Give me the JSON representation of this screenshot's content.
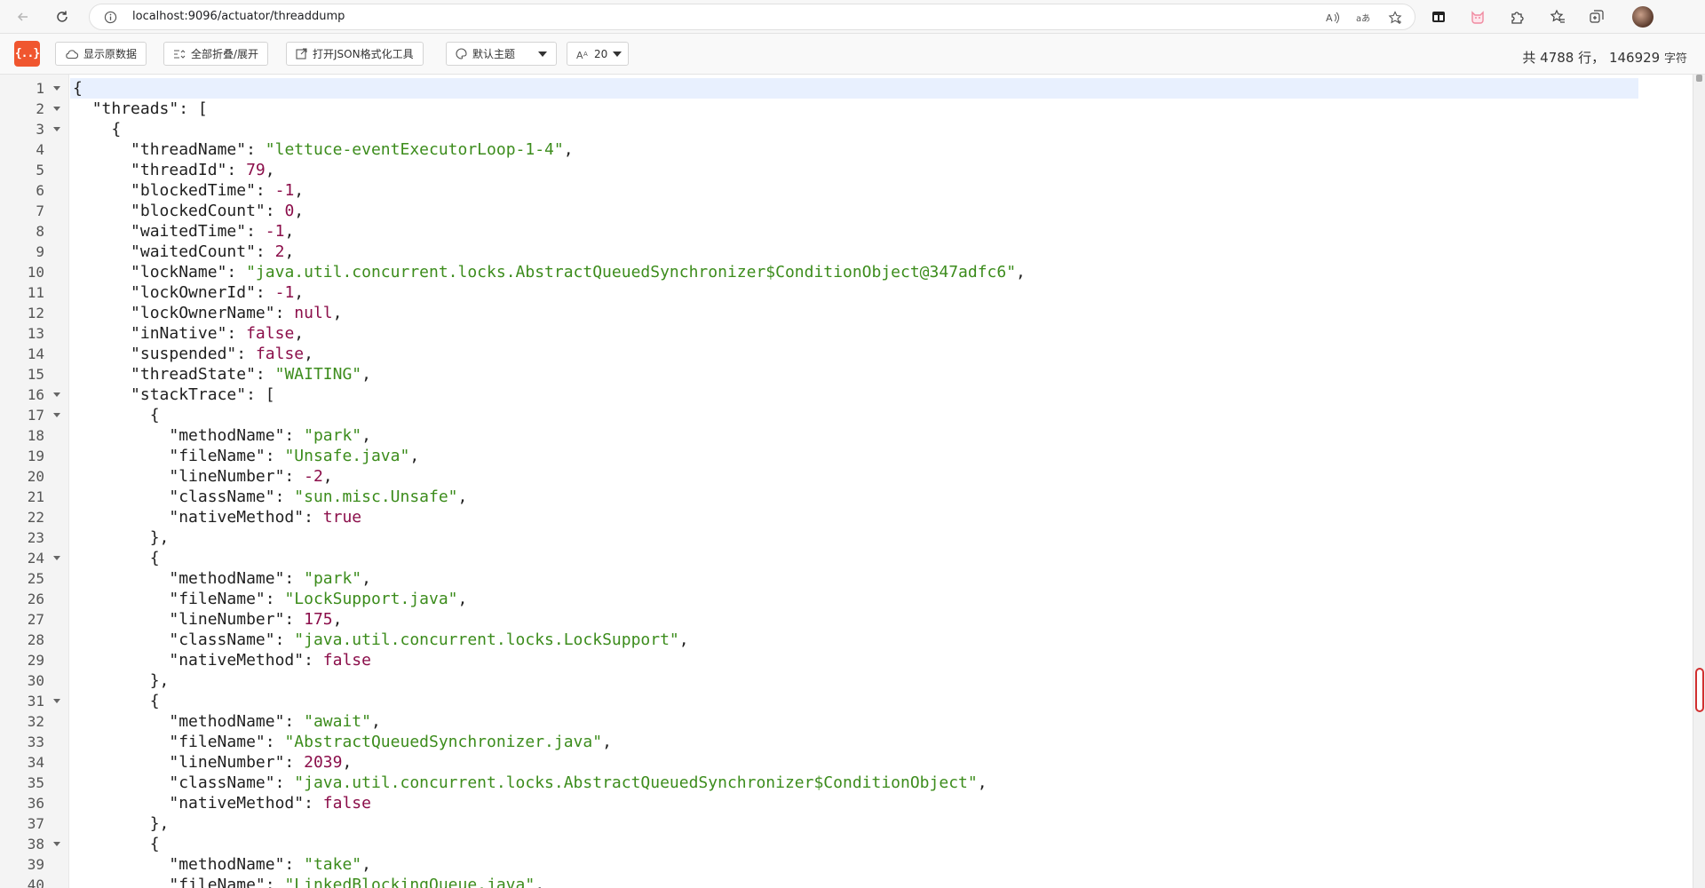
{
  "browser": {
    "url": "localhost:9096/actuator/threaddump"
  },
  "toolbar": {
    "logo_text": "{..}",
    "show_raw_label": "显示原数据",
    "toggle_fold_label": "全部折叠/展开",
    "open_formatter_label": "打开JSON格式化工具",
    "theme_label": "默认主题",
    "font_size_value": "20",
    "stats": {
      "prefix": "共",
      "lines": "4788",
      "lines_unit": "行，",
      "chars": "146929",
      "chars_unit": "字符"
    }
  },
  "editor": {
    "fold_lines": [
      1,
      2,
      3,
      16,
      17,
      24,
      31,
      38
    ],
    "lines": [
      [
        [
          "p",
          "{"
        ]
      ],
      [
        [
          "p",
          "  "
        ],
        [
          "k",
          "\"threads\""
        ],
        [
          "p",
          ": ["
        ]
      ],
      [
        [
          "p",
          "    {"
        ]
      ],
      [
        [
          "p",
          "      "
        ],
        [
          "k",
          "\"threadName\""
        ],
        [
          "p",
          ": "
        ],
        [
          "s",
          "\"lettuce-eventExecutorLoop-1-4\""
        ],
        [
          "p",
          ","
        ]
      ],
      [
        [
          "p",
          "      "
        ],
        [
          "k",
          "\"threadId\""
        ],
        [
          "p",
          ": "
        ],
        [
          "n",
          "79"
        ],
        [
          "p",
          ","
        ]
      ],
      [
        [
          "p",
          "      "
        ],
        [
          "k",
          "\"blockedTime\""
        ],
        [
          "p",
          ": "
        ],
        [
          "n",
          "-1"
        ],
        [
          "p",
          ","
        ]
      ],
      [
        [
          "p",
          "      "
        ],
        [
          "k",
          "\"blockedCount\""
        ],
        [
          "p",
          ": "
        ],
        [
          "n",
          "0"
        ],
        [
          "p",
          ","
        ]
      ],
      [
        [
          "p",
          "      "
        ],
        [
          "k",
          "\"waitedTime\""
        ],
        [
          "p",
          ": "
        ],
        [
          "n",
          "-1"
        ],
        [
          "p",
          ","
        ]
      ],
      [
        [
          "p",
          "      "
        ],
        [
          "k",
          "\"waitedCount\""
        ],
        [
          "p",
          ": "
        ],
        [
          "n",
          "2"
        ],
        [
          "p",
          ","
        ]
      ],
      [
        [
          "p",
          "      "
        ],
        [
          "k",
          "\"lockName\""
        ],
        [
          "p",
          ": "
        ],
        [
          "s",
          "\"java.util.concurrent.locks.AbstractQueuedSynchronizer$ConditionObject@347adfc6\""
        ],
        [
          "p",
          ","
        ]
      ],
      [
        [
          "p",
          "      "
        ],
        [
          "k",
          "\"lockOwnerId\""
        ],
        [
          "p",
          ": "
        ],
        [
          "n",
          "-1"
        ],
        [
          "p",
          ","
        ]
      ],
      [
        [
          "p",
          "      "
        ],
        [
          "k",
          "\"lockOwnerName\""
        ],
        [
          "p",
          ": "
        ],
        [
          "b",
          "null"
        ],
        [
          "p",
          ","
        ]
      ],
      [
        [
          "p",
          "      "
        ],
        [
          "k",
          "\"inNative\""
        ],
        [
          "p",
          ": "
        ],
        [
          "b",
          "false"
        ],
        [
          "p",
          ","
        ]
      ],
      [
        [
          "p",
          "      "
        ],
        [
          "k",
          "\"suspended\""
        ],
        [
          "p",
          ": "
        ],
        [
          "b",
          "false"
        ],
        [
          "p",
          ","
        ]
      ],
      [
        [
          "p",
          "      "
        ],
        [
          "k",
          "\"threadState\""
        ],
        [
          "p",
          ": "
        ],
        [
          "s",
          "\"WAITING\""
        ],
        [
          "p",
          ","
        ]
      ],
      [
        [
          "p",
          "      "
        ],
        [
          "k",
          "\"stackTrace\""
        ],
        [
          "p",
          ": ["
        ]
      ],
      [
        [
          "p",
          "        {"
        ]
      ],
      [
        [
          "p",
          "          "
        ],
        [
          "k",
          "\"methodName\""
        ],
        [
          "p",
          ": "
        ],
        [
          "s",
          "\"park\""
        ],
        [
          "p",
          ","
        ]
      ],
      [
        [
          "p",
          "          "
        ],
        [
          "k",
          "\"fileName\""
        ],
        [
          "p",
          ": "
        ],
        [
          "s",
          "\"Unsafe.java\""
        ],
        [
          "p",
          ","
        ]
      ],
      [
        [
          "p",
          "          "
        ],
        [
          "k",
          "\"lineNumber\""
        ],
        [
          "p",
          ": "
        ],
        [
          "n",
          "-2"
        ],
        [
          "p",
          ","
        ]
      ],
      [
        [
          "p",
          "          "
        ],
        [
          "k",
          "\"className\""
        ],
        [
          "p",
          ": "
        ],
        [
          "s",
          "\"sun.misc.Unsafe\""
        ],
        [
          "p",
          ","
        ]
      ],
      [
        [
          "p",
          "          "
        ],
        [
          "k",
          "\"nativeMethod\""
        ],
        [
          "p",
          ": "
        ],
        [
          "b",
          "true"
        ]
      ],
      [
        [
          "p",
          "        },"
        ]
      ],
      [
        [
          "p",
          "        {"
        ]
      ],
      [
        [
          "p",
          "          "
        ],
        [
          "k",
          "\"methodName\""
        ],
        [
          "p",
          ": "
        ],
        [
          "s",
          "\"park\""
        ],
        [
          "p",
          ","
        ]
      ],
      [
        [
          "p",
          "          "
        ],
        [
          "k",
          "\"fileName\""
        ],
        [
          "p",
          ": "
        ],
        [
          "s",
          "\"LockSupport.java\""
        ],
        [
          "p",
          ","
        ]
      ],
      [
        [
          "p",
          "          "
        ],
        [
          "k",
          "\"lineNumber\""
        ],
        [
          "p",
          ": "
        ],
        [
          "n",
          "175"
        ],
        [
          "p",
          ","
        ]
      ],
      [
        [
          "p",
          "          "
        ],
        [
          "k",
          "\"className\""
        ],
        [
          "p",
          ": "
        ],
        [
          "s",
          "\"java.util.concurrent.locks.LockSupport\""
        ],
        [
          "p",
          ","
        ]
      ],
      [
        [
          "p",
          "          "
        ],
        [
          "k",
          "\"nativeMethod\""
        ],
        [
          "p",
          ": "
        ],
        [
          "b",
          "false"
        ]
      ],
      [
        [
          "p",
          "        },"
        ]
      ],
      [
        [
          "p",
          "        {"
        ]
      ],
      [
        [
          "p",
          "          "
        ],
        [
          "k",
          "\"methodName\""
        ],
        [
          "p",
          ": "
        ],
        [
          "s",
          "\"await\""
        ],
        [
          "p",
          ","
        ]
      ],
      [
        [
          "p",
          "          "
        ],
        [
          "k",
          "\"fileName\""
        ],
        [
          "p",
          ": "
        ],
        [
          "s",
          "\"AbstractQueuedSynchronizer.java\""
        ],
        [
          "p",
          ","
        ]
      ],
      [
        [
          "p",
          "          "
        ],
        [
          "k",
          "\"lineNumber\""
        ],
        [
          "p",
          ": "
        ],
        [
          "n",
          "2039"
        ],
        [
          "p",
          ","
        ]
      ],
      [
        [
          "p",
          "          "
        ],
        [
          "k",
          "\"className\""
        ],
        [
          "p",
          ": "
        ],
        [
          "s",
          "\"java.util.concurrent.locks.AbstractQueuedSynchronizer$ConditionObject\""
        ],
        [
          "p",
          ","
        ]
      ],
      [
        [
          "p",
          "          "
        ],
        [
          "k",
          "\"nativeMethod\""
        ],
        [
          "p",
          ": "
        ],
        [
          "b",
          "false"
        ]
      ],
      [
        [
          "p",
          "        },"
        ]
      ],
      [
        [
          "p",
          "        {"
        ]
      ],
      [
        [
          "p",
          "          "
        ],
        [
          "k",
          "\"methodName\""
        ],
        [
          "p",
          ": "
        ],
        [
          "s",
          "\"take\""
        ],
        [
          "p",
          ","
        ]
      ],
      [
        [
          "p",
          "          "
        ],
        [
          "k",
          "\"fileName\""
        ],
        [
          "p",
          ": "
        ],
        [
          "s",
          "\"LinkedBlockingQueue.java\""
        ],
        [
          "p",
          ","
        ]
      ]
    ]
  },
  "icons": {
    "back": "back-arrow-icon",
    "reload": "reload-icon",
    "info": "info-icon",
    "read_aloud": "read-aloud-icon",
    "translate": "translate-icon",
    "favorite": "add-favorite-icon",
    "ext1": "extension-toolbar-icon",
    "ext2": "cat-extension-icon",
    "extensions": "extensions-puzzle-icon",
    "favorites": "favorites-icon",
    "collections": "collections-icon",
    "avatar": "profile-avatar"
  },
  "colors": {
    "logo": "#f0562f",
    "string": "#3c8c1c",
    "number": "#8b0e4a",
    "active_line": "#e8f0fe",
    "scroll_thumb_border": "#d13030"
  }
}
